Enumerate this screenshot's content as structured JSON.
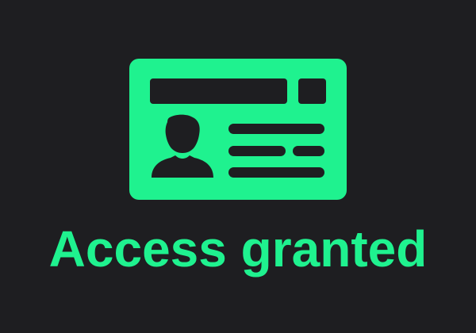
{
  "status": {
    "message": "Access granted",
    "icon": "id-card-icon"
  },
  "colors": {
    "background": "#1e1e21",
    "accent": "#1ff28f"
  }
}
